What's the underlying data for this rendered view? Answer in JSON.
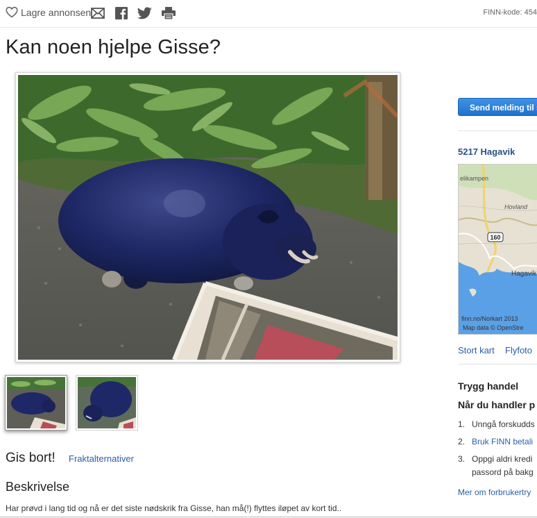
{
  "toolbar": {
    "save_label": "Lagre annonsen",
    "icons": [
      "heart-icon",
      "mail-icon",
      "facebook-icon",
      "twitter-icon",
      "print-icon"
    ],
    "finn_code": "FINN-kode: 454"
  },
  "ad": {
    "title": "Kan noen hjelpe Gisse?",
    "price": "Gis bort!",
    "freight_link": "Fraktalternativer",
    "description_heading": "Beskrivelse",
    "description_text": "Har prøvd i lang tid og nå er det siste nødskrik fra Gisse, han må(!) flyttes iløpet av kort tid.."
  },
  "sidebar": {
    "send_button": "Send melding til s",
    "location": "5217 Hagavik",
    "map": {
      "labels": [
        "elikampen",
        "Hovland",
        "160",
        "Hagavik"
      ],
      "attribution_1": "finn.no/Norkart 2013",
      "attribution_2": "Map data © OpenStre"
    },
    "map_links": [
      "Stort kart",
      "Flyfoto"
    ],
    "safe_trade_heading": "Trygg handel",
    "safe_trade_sub": "Når du handler p",
    "tips": [
      {
        "num": "1.",
        "text": "Unngå forskudds"
      },
      {
        "num": "2.",
        "text": "Bruk FINN betali"
      },
      {
        "num": "3.",
        "text": "Oppgi aldri kredi"
      },
      {
        "num": "",
        "text": "passord på bakg"
      }
    ],
    "more_link": "Mer om forbrukertry"
  },
  "colors": {
    "link": "#2a5fa8",
    "button": "#2a7fd8",
    "location": "#2a5088"
  }
}
